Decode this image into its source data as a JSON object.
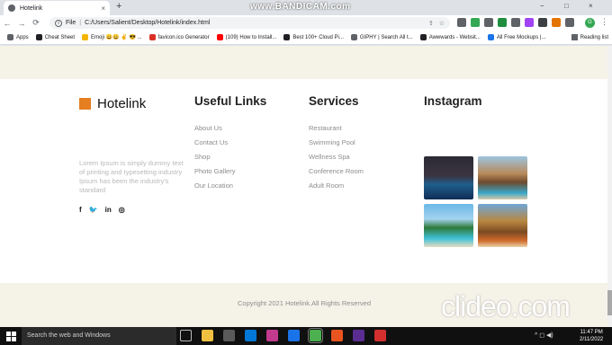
{
  "browser": {
    "tab_title": "Hotelink",
    "tab_close": "×",
    "new_tab": "+",
    "recorder_watermark": "www.BANDICAM.com",
    "window_controls": [
      "−",
      "□",
      "×"
    ],
    "nav": {
      "back": "←",
      "forward": "→",
      "reload": "⟳"
    },
    "address_scheme": "File",
    "address_url": "C:/Users/Salient/Desktop/Hotelink/index.html",
    "bookmarks": [
      {
        "label": "Apps",
        "color": "#5f6368"
      },
      {
        "label": "Cheat Sheet",
        "color": "#202124"
      },
      {
        "label": "Emoji 😀😀 ✌️ 😎 ...",
        "color": "#f4b400"
      },
      {
        "label": "favicon.ico Generator",
        "color": "#d93025"
      },
      {
        "label": "(109) How to Install...",
        "color": "#ff0000"
      },
      {
        "label": "Best 100+ Cloud Pi...",
        "color": "#202124"
      },
      {
        "label": "GIPHY | Search All t...",
        "color": "#5f6368"
      },
      {
        "label": "Awwwards - Websit...",
        "color": "#202124"
      },
      {
        "label": "All Free Mockups |...",
        "color": "#1a73e8"
      }
    ],
    "reading_list": "Reading list",
    "profile_initial": "G",
    "extension_colors": [
      "#5f6368",
      "#34a853",
      "#5f6368",
      "#1e8e3e",
      "#5f6368",
      "#a142f4",
      "#3c4043",
      "#e37400",
      "#5f6368"
    ]
  },
  "footer": {
    "brand_name": "Hotelink",
    "brand_color": "#e67e22",
    "description": "Lorem Ipsum is simply dummy text of printing and typesetting industry Ipsum has been the industry's standard",
    "socials": [
      "f",
      "🐦",
      "in",
      "◎"
    ],
    "useful_links": {
      "title": "Useful Links",
      "items": [
        "About Us",
        "Contact Us",
        "Shop",
        "Photo Gallery",
        "Our Location"
      ]
    },
    "services": {
      "title": "Services",
      "items": [
        "Restaurant",
        "Swimming Pool",
        "Wellness Spa",
        "Conference Room",
        "Adult Room"
      ]
    },
    "instagram": {
      "title": "Instagram"
    },
    "copyright": "Copyright 2021 Hotelink.All Rights Reserved"
  },
  "video_watermark": "clideo.com",
  "taskbar": {
    "search_placeholder": "Search the web and Windows",
    "app_colors": [
      "#2b2b2b",
      "#f0c040",
      "#5a5a5a",
      "#0078d7",
      "#c23a8e",
      "#1a73e8",
      "#4caf50",
      "#e8541f",
      "#5c2d91",
      "#d32f2f"
    ],
    "tray": "^ ◻ ◀)",
    "time": "11:47 PM",
    "date": "2/11/2022"
  }
}
